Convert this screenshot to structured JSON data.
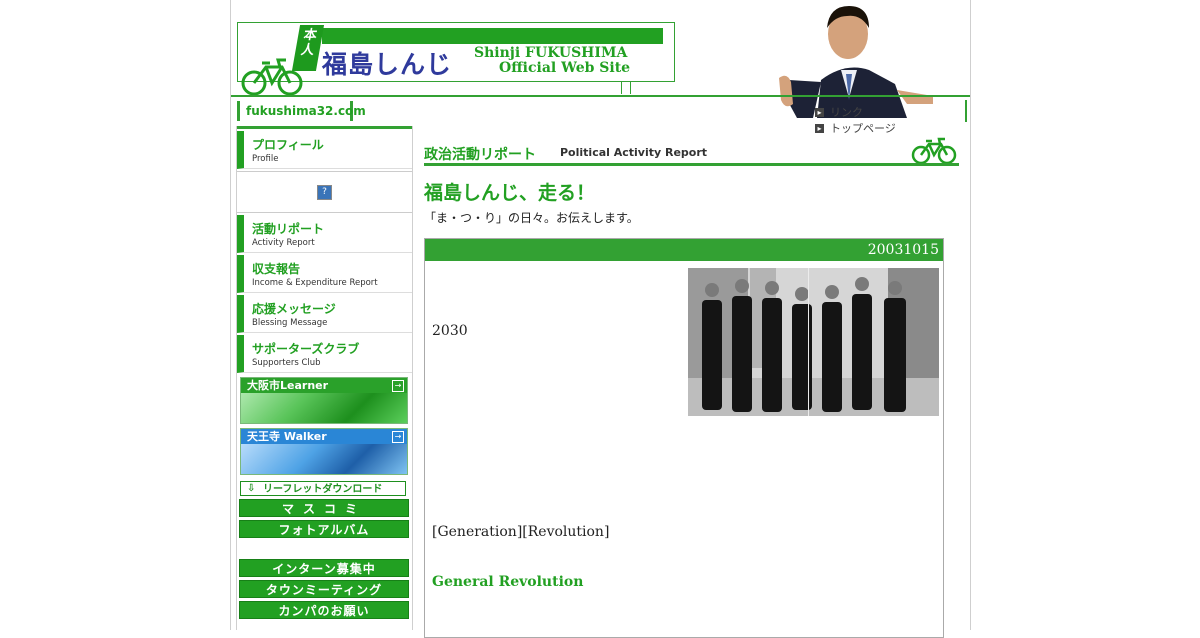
{
  "header": {
    "honnin_tag": "本人",
    "site_name_jp": "福島しんじ",
    "site_name_en_line1": "Shinji FUKUSHIMA",
    "site_name_en_line2": "Official Web Site",
    "domain": "fukushima32.com",
    "toplinks": [
      {
        "label": "リンク",
        "icon": "arrow-box-icon"
      },
      {
        "label": "トップページ",
        "icon": "arrow-box-icon"
      }
    ]
  },
  "sidebar": {
    "nav": [
      {
        "jp": "プロフィール",
        "en": "Profile"
      },
      {
        "jp": "活動リポート",
        "en": "Activity Report"
      },
      {
        "jp": "収支報告",
        "en": "Income & Expenditure Report"
      },
      {
        "jp": "応援メッセージ",
        "en": "Blessing Message"
      },
      {
        "jp": "サポーターズクラブ",
        "en": "Supporters Club"
      }
    ],
    "banners": [
      {
        "label": "大阪市Learner"
      },
      {
        "label": "天王寺 Walker"
      }
    ],
    "leaflet_label": "リーフレットダウンロード",
    "buttons": [
      "マスコミ",
      "フォトアルバム",
      "インターン募集中",
      "タウンミーティング",
      "カンパのお願い"
    ]
  },
  "main": {
    "section_jp": "政治活動リポート",
    "section_en": "Political Activity Report",
    "title": "福島しんじ、走る！",
    "lead": "「ま・つ・り」の日々。お伝えします。",
    "report": {
      "date": "20031015",
      "year_text": "2030",
      "tags": "[Generation][Revolution]",
      "subheading": "General Revolution"
    }
  },
  "colors": {
    "accent": "#22a022",
    "logo_text": "#2f3a9c"
  }
}
